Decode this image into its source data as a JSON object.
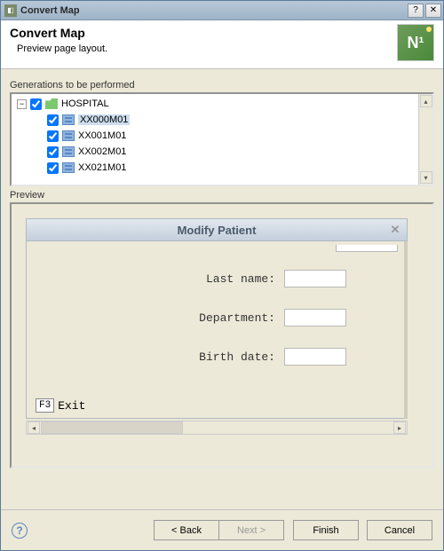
{
  "window": {
    "title": "Convert Map"
  },
  "header": {
    "title": "Convert Map",
    "subtitle": "Preview page layout.",
    "logo_text": "N¹"
  },
  "sections": {
    "generations_label": "Generations to be performed",
    "preview_label": "Preview"
  },
  "tree": {
    "root": {
      "label": "HOSPITAL",
      "checked": true,
      "expanded": true
    },
    "items": [
      {
        "label": "XX000M01",
        "checked": true,
        "selected": true
      },
      {
        "label": "XX001M01",
        "checked": true,
        "selected": false
      },
      {
        "label": "XX002M01",
        "checked": true,
        "selected": false
      },
      {
        "label": "XX021M01",
        "checked": true,
        "selected": false
      }
    ]
  },
  "preview": {
    "title": "Modify Patient",
    "fields": [
      {
        "label": "Last name:"
      },
      {
        "label": "Department:"
      },
      {
        "label": "Birth date:"
      }
    ],
    "footer_key": "F3",
    "footer_label": "Exit"
  },
  "buttons": {
    "back": "< Back",
    "next": "Next >",
    "finish": "Finish",
    "cancel": "Cancel"
  }
}
